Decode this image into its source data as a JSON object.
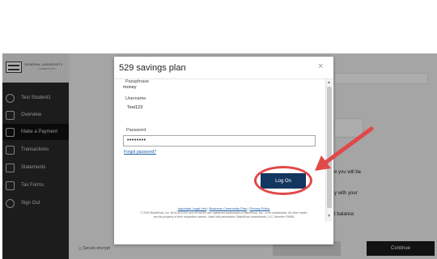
{
  "app": {
    "logo": {
      "line1": "GENERAL UNIVERSITY",
      "line2": "CAMBUS CITY"
    },
    "nav": [
      {
        "label": "Test Student1",
        "icon": "user-icon"
      },
      {
        "label": "Overview",
        "icon": "home-icon"
      },
      {
        "label": "Make a Payment",
        "icon": "payment-icon"
      },
      {
        "label": "Transactions",
        "icon": "transactions-icon"
      },
      {
        "label": "Statements",
        "icon": "statements-icon"
      },
      {
        "label": "Tax Forms",
        "icon": "tax-forms-icon"
      },
      {
        "label": "Sign Out",
        "icon": "sign-out-icon"
      }
    ],
    "active_nav": "Make a Payment",
    "background": {
      "right_text_1": "e you will be",
      "right_text_2": "y with your",
      "right_text_3": "t balance",
      "footer_note": "Secure encrypt",
      "continue_label": "Continue"
    }
  },
  "modal": {
    "title": "529 savings plan",
    "close_label": "×",
    "passphrase": {
      "label": "Passphrase",
      "value": "money"
    },
    "username": {
      "label": "Username",
      "value": "Test123"
    },
    "password": {
      "label": "Password",
      "value": "••••••••"
    },
    "forgot_password_label": "Forgot password?",
    "logon_label": "Log On",
    "footer": {
      "link_important": "Important Legal Info",
      "sep1": "|",
      "link_community": "Business Community Plan",
      "sep2": "|",
      "link_privacy": "Privacy Policy",
      "legal_line1": "© 2020 BlackRock, Inc. BLACKROCK and iSHARES are registered trademarks of BlackRock, Inc., or its subsidiaries. All other marks",
      "legal_line2": "are the property of their respective owners. Used with permission: BlackRock Investments, LLC, Member FINRA"
    }
  },
  "annotation": {
    "color": "#e14848"
  }
}
